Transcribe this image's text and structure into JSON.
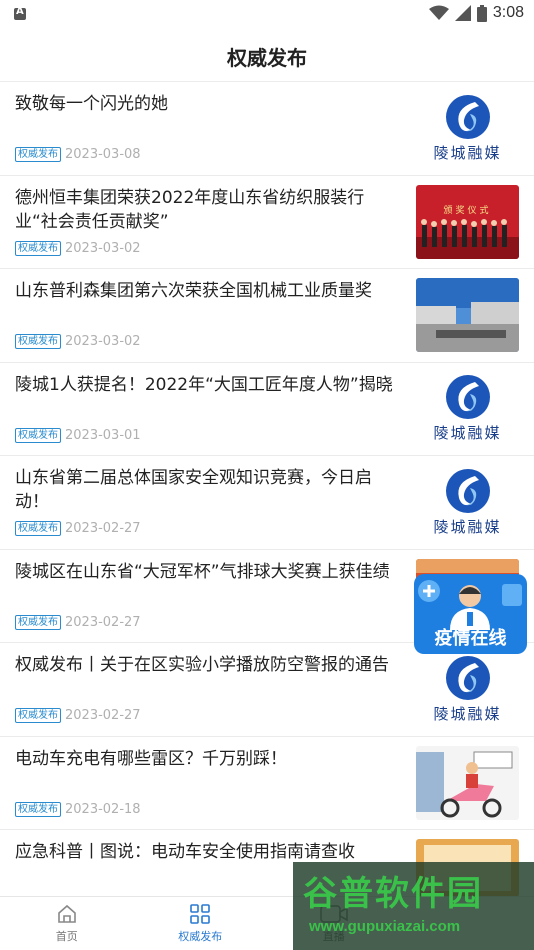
{
  "status_bar": {
    "time": "3:08"
  },
  "header": {
    "title": "权威发布"
  },
  "news": [
    {
      "title": "致敬每一个闪光的她",
      "tag": "权威发布",
      "date": "2023-03-08",
      "thumb": "logo"
    },
    {
      "title": "德州恒丰集团荣获2022年度山东省纺织服装行业“社会责任贡献奖”",
      "tag": "权威发布",
      "date": "2023-03-02",
      "thumb": "ceremony"
    },
    {
      "title": "山东普利森集团第六次荣获全国机械工业质量奖",
      "tag": "权威发布",
      "date": "2023-03-02",
      "thumb": "factory"
    },
    {
      "title": "陵城1人获提名！2022年“大国工匠年度人物”揭晓",
      "tag": "权威发布",
      "date": "2023-03-01",
      "thumb": "logo"
    },
    {
      "title": "山东省第二届总体国家安全观知识竞赛，今日启动！",
      "tag": "权威发布",
      "date": "2023-02-27",
      "thumb": "logo"
    },
    {
      "title": "陵城区在山东省“大冠军杯”气排球大奖赛上获佳绩",
      "tag": "权威发布",
      "date": "2023-02-27",
      "thumb": "sports"
    },
    {
      "title": "权威发布丨关于在区实验小学播放防空警报的通告",
      "tag": "权威发布",
      "date": "2023-02-27",
      "thumb": "logo"
    },
    {
      "title": "电动车充电有哪些雷区？千万别踩！",
      "tag": "权威发布",
      "date": "2023-02-18",
      "thumb": "ebike"
    },
    {
      "title": "应急科普丨图说：电动车安全使用指南请查收",
      "tag": "",
      "date": "",
      "thumb": "guide"
    }
  ],
  "logo": {
    "text": "陵城融媒"
  },
  "thumb_text": {
    "ceremony": "颁奖仪式"
  },
  "float_badge": {
    "label": "疫情在线"
  },
  "bottom_nav": [
    {
      "label": "首页",
      "icon": "home-icon",
      "active": false
    },
    {
      "label": "权威发布",
      "icon": "grid-icon",
      "active": true
    },
    {
      "label": "直播",
      "icon": "video-icon",
      "active": false
    }
  ],
  "watermark": {
    "main": "谷普软件园",
    "url": "www.gupuxiazai.com"
  },
  "colors": {
    "accent": "#2a7ad0",
    "tag": "#2a8ccf",
    "badge": "#1f7fe0",
    "watermark": "#3ac14a"
  }
}
